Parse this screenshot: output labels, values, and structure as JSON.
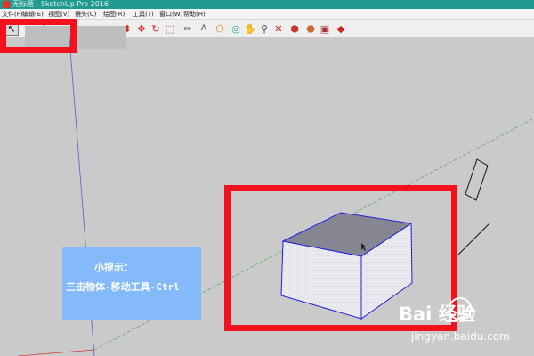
{
  "window": {
    "title": "无标题 - SketchUp Pro 2016"
  },
  "menu": [
    {
      "label": "文件(F)"
    },
    {
      "label": "编辑(E)"
    },
    {
      "label": "视图(V)"
    },
    {
      "label": "镜头(C)"
    },
    {
      "label": "绘图(R)"
    },
    {
      "label": "工具(T)"
    },
    {
      "label": "窗口(W)"
    },
    {
      "label": "帮助(H)"
    }
  ],
  "toolbar": {
    "tools": [
      {
        "name": "select-tool-icon",
        "glyph": "↖"
      },
      {
        "name": "eraser-tool-icon",
        "glyph": "◕"
      },
      {
        "name": "pencil-tool-icon",
        "glyph": "✎"
      },
      {
        "name": "arc-tool-icon",
        "glyph": "◜"
      },
      {
        "name": "rectangle-tool-icon",
        "glyph": "▭"
      },
      {
        "name": "pushpull-tool-icon",
        "glyph": "⬍"
      },
      {
        "name": "move-tool-icon",
        "glyph": "✥"
      },
      {
        "name": "rotate-tool-icon",
        "glyph": "↻"
      },
      {
        "name": "scale-tool-icon",
        "glyph": "⬚"
      },
      {
        "name": "tape-measure-icon",
        "glyph": "✏"
      },
      {
        "name": "text-tool-icon",
        "glyph": "A"
      },
      {
        "name": "paint-bucket-icon",
        "glyph": "⬠"
      },
      {
        "name": "orbit-tool-icon",
        "glyph": "◎"
      },
      {
        "name": "pan-tool-icon",
        "glyph": "✋"
      },
      {
        "name": "zoom-tool-icon",
        "glyph": "⚲"
      },
      {
        "name": "zoom-extents-icon",
        "glyph": "✕"
      },
      {
        "name": "warehouse-icon",
        "glyph": "⬢"
      },
      {
        "name": "extension-warehouse-icon",
        "glyph": "⬣"
      },
      {
        "name": "layout-icon",
        "glyph": "▣"
      },
      {
        "name": "ruby-icon",
        "glyph": "◆"
      }
    ]
  },
  "tip": {
    "title": "小提示：",
    "body": "三击物体-移动工具-Ctrl"
  },
  "watermark": {
    "main": "Bai 经验",
    "sub": "jingyan.baidu.com"
  },
  "colors": {
    "highlight": "#f2121e",
    "tip_background": "#84bafc",
    "selection": "#2020e0",
    "axis_green": "#3fb04a",
    "axis_blue": "#5a5ad8",
    "axis_red": "#d03a3a"
  }
}
